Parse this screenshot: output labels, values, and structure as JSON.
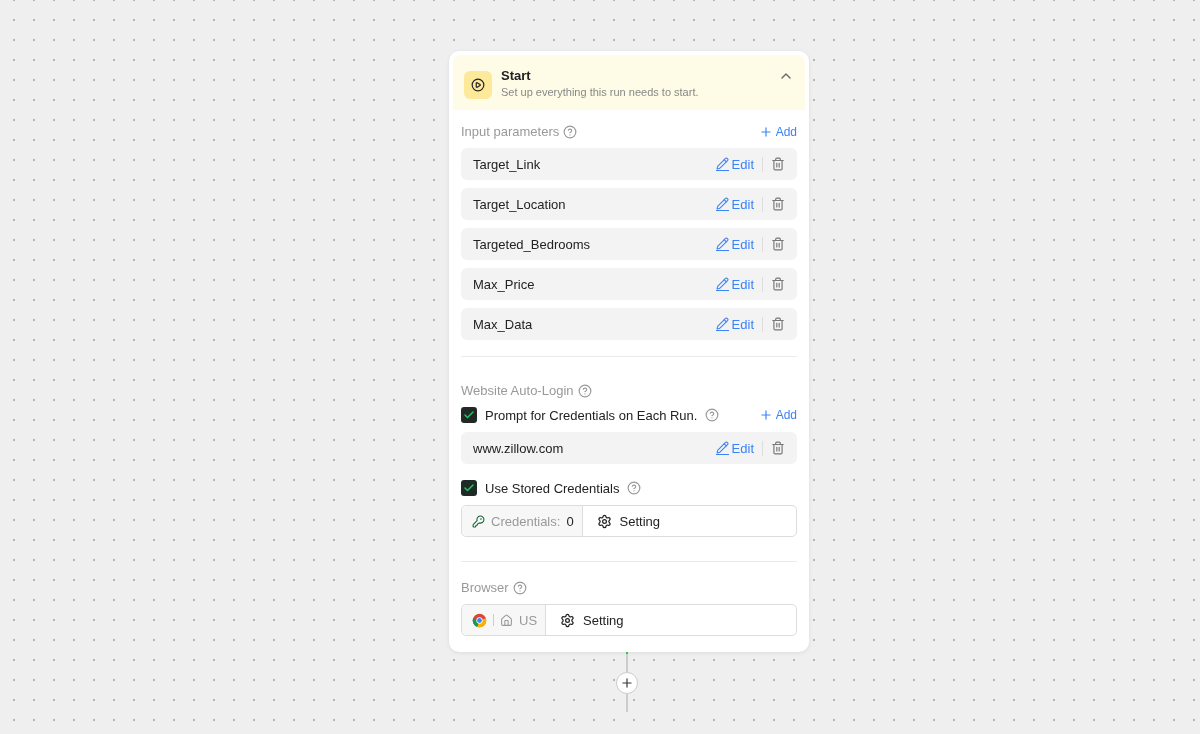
{
  "node": {
    "title": "Start",
    "subtitle": "Set up everything this run needs to start.",
    "expanded": true
  },
  "input_parameters": {
    "label": "Input parameters",
    "add": "Add",
    "items": [
      {
        "name": "Target_Link",
        "edit": "Edit"
      },
      {
        "name": "Target_Location",
        "edit": "Edit"
      },
      {
        "name": "Targeted_Bedrooms",
        "edit": "Edit"
      },
      {
        "name": "Max_Price",
        "edit": "Edit"
      },
      {
        "name": "Max_Data",
        "edit": "Edit"
      }
    ]
  },
  "auto_login": {
    "label": "Website Auto-Login",
    "prompt": {
      "label": "Prompt for Credentials on Each Run.",
      "checked": true,
      "add": "Add"
    },
    "sites": [
      {
        "name": "www.zillow.com",
        "edit": "Edit"
      }
    ],
    "stored": {
      "label": "Use Stored Credentials",
      "checked": true
    },
    "credentials": {
      "label": "Credentials:",
      "count": "0",
      "setting": "Setting"
    }
  },
  "browser": {
    "label": "Browser",
    "region": "US",
    "setting": "Setting"
  }
}
